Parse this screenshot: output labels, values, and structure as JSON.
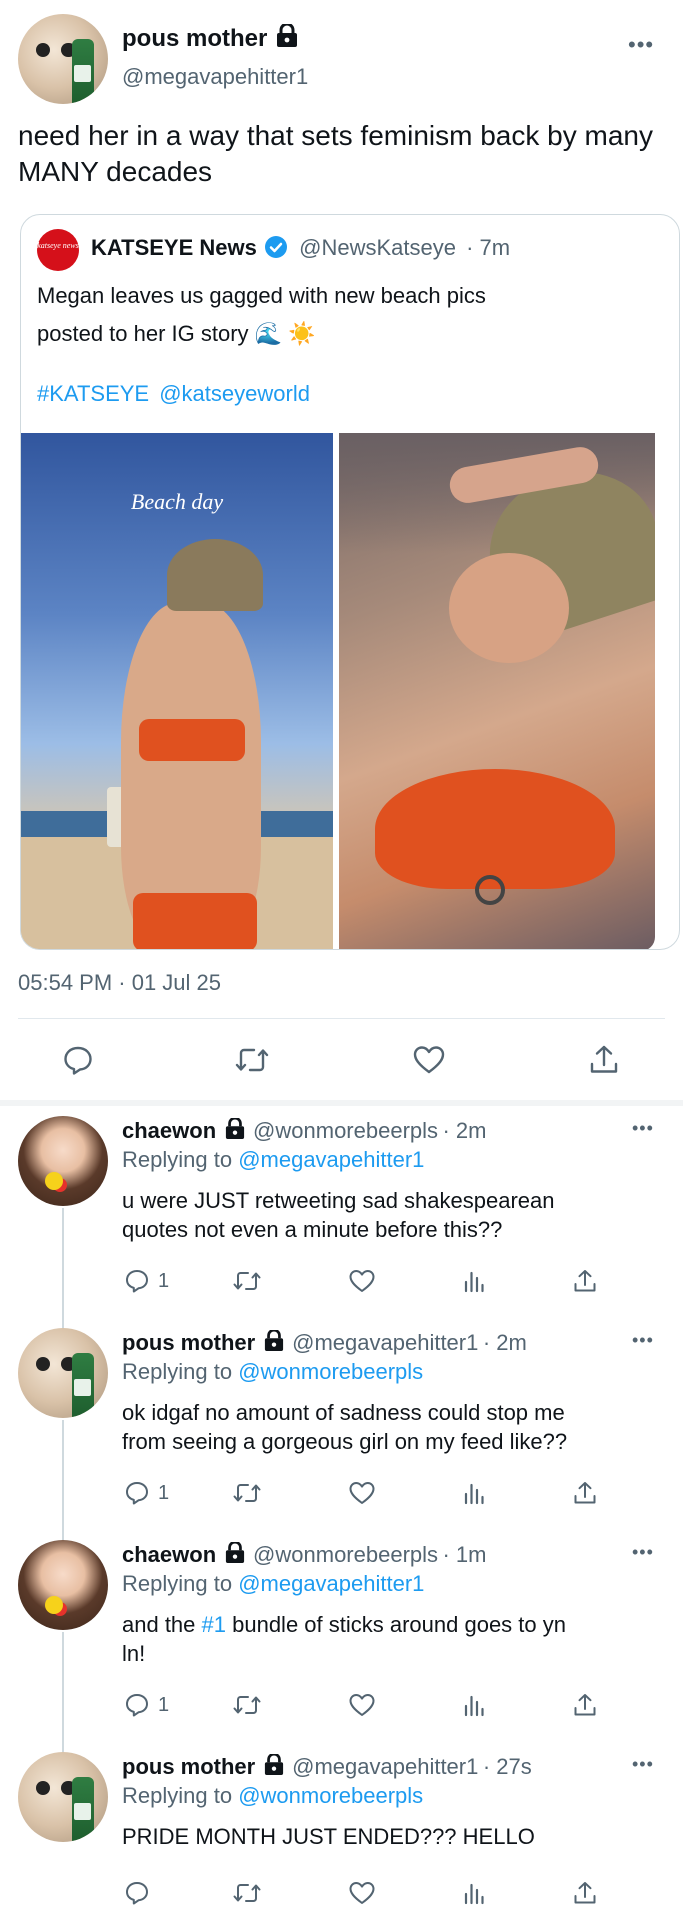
{
  "main_tweet": {
    "name": "pous mother",
    "handle": "@megavapehitter1",
    "text": "need her in a way that sets feminism back by many MANY decades",
    "timestamp": "05:54 PM · 01 Jul 25"
  },
  "quote": {
    "name": "KATSEYE News",
    "handle": "@NewsKatseye",
    "time": "· 7m",
    "text_line1": "Megan leaves us gagged with new beach pics",
    "text_line2": "posted to her IG story 🌊 ☀️",
    "hashtag": "#KATSEYE",
    "mention": "@katseyeworld",
    "image_caption": "Beach day",
    "avatar_text": "katseye news"
  },
  "replies": [
    {
      "name": "chaewon",
      "handle": "@wonmorebeerpls",
      "time": "· 2m",
      "replying_prefix": "Replying to ",
      "replying_to": "@megavapehitter1",
      "line1": "u were JUST retweeting sad shakespearean",
      "line2": "quotes not even a minute before this??",
      "reply_count": "1"
    },
    {
      "name": "pous mother",
      "handle": "@megavapehitter1",
      "time": "· 2m",
      "replying_prefix": "Replying to ",
      "replying_to": "@wonmorebeerpls",
      "line1": "ok idgaf no amount of sadness could stop me",
      "line2": "from seeing a gorgeous girl on my feed like??",
      "reply_count": "1"
    },
    {
      "name": "chaewon",
      "handle": "@wonmorebeerpls",
      "time": "· 1m",
      "replying_prefix": "Replying to ",
      "replying_to": "@megavapehitter1",
      "line1_pre": "and the ",
      "line1_link": "#1",
      "line1_post": " bundle of sticks around goes to yn",
      "line2": "ln!",
      "reply_count": "1"
    },
    {
      "name": "pous mother",
      "handle": "@megavapehitter1",
      "time": "· 27s",
      "replying_prefix": "Replying to ",
      "replying_to": "@wonmorebeerpls",
      "line1": "PRIDE MONTH JUST ENDED??? HELLO",
      "reply_count": ""
    }
  ],
  "more_label": "•••",
  "colors": {
    "link": "#1d9bf0",
    "muted": "#536471",
    "verified": "#1d9bf0"
  },
  "icons": [
    "reply-icon",
    "retweet-icon",
    "like-icon",
    "share-icon",
    "views-icon",
    "lock-icon",
    "verified-icon"
  ]
}
